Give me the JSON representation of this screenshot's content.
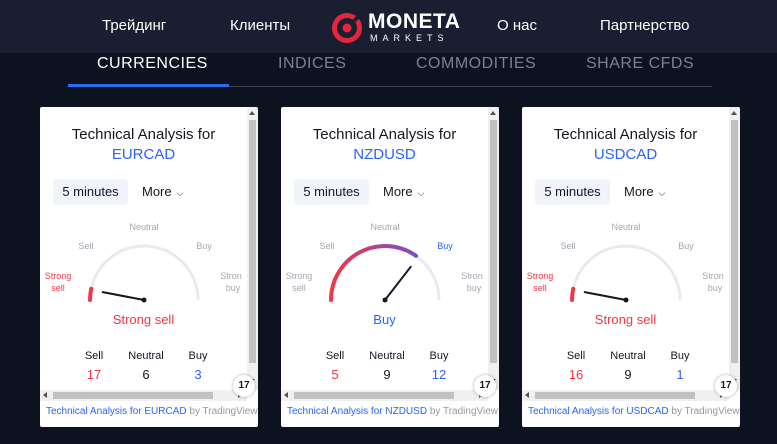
{
  "nav": {
    "items": [
      "Трейдинг",
      "Клиенты",
      "О нас",
      "Партнерство"
    ],
    "logo": {
      "name": "MONETA",
      "sub": "MARKETS"
    }
  },
  "tabs": [
    "CURRENCIES",
    "INDICES",
    "COMMODITIES",
    "SHARE CFDS"
  ],
  "active_tab": "CURRENCIES",
  "colors": {
    "background": "#0d1220",
    "header": "#191f30",
    "accent": "#2a6cf0",
    "sell": "#f23645",
    "buy": "#2962ff",
    "logo_red": "#e3263c"
  },
  "widgets": [
    {
      "title": "Technical Analysis for",
      "symbol": "EURCAD",
      "interval": "5 minutes",
      "more_label": "More",
      "gauge_labels": {
        "neutral": "Neutral",
        "sell": "Sell",
        "buy": "Buy",
        "strong_sell_1": "Strong",
        "strong_sell_2": "sell",
        "strong_buy_1": "Stron",
        "strong_buy_2": "buy"
      },
      "needle_value": -0.88,
      "result": "Strong sell",
      "result_type": "sell",
      "counts": {
        "sell_label": "Sell",
        "neutral_label": "Neutral",
        "buy_label": "Buy",
        "sell": "17",
        "neutral": "6",
        "buy": "3"
      },
      "footer": {
        "link": "Technical Analysis for EURCAD",
        "suffix": " by TradingView"
      },
      "badge": "17"
    },
    {
      "title": "Technical Analysis for",
      "symbol": "NZDUSD",
      "interval": "5 minutes",
      "more_label": "More",
      "gauge_labels": {
        "neutral": "Neutral",
        "sell": "Sell",
        "buy": "Buy",
        "strong_sell_1": "Strong",
        "strong_sell_2": "sell",
        "strong_buy_1": "Stron",
        "strong_buy_2": "buy"
      },
      "needle_value": 0.42,
      "result": "Buy",
      "result_type": "buy",
      "counts": {
        "sell_label": "Sell",
        "neutral_label": "Neutral",
        "buy_label": "Buy",
        "sell": "5",
        "neutral": "9",
        "buy": "12"
      },
      "footer": {
        "link": "Technical Analysis for NZDUSD",
        "suffix": " by TradingView"
      },
      "badge": "17"
    },
    {
      "title": "Technical Analysis for",
      "symbol": "USDCAD",
      "interval": "5 minutes",
      "more_label": "More",
      "gauge_labels": {
        "neutral": "Neutral",
        "sell": "Sell",
        "buy": "Buy",
        "strong_sell_1": "Strong",
        "strong_sell_2": "sell",
        "strong_buy_1": "Stron",
        "strong_buy_2": "buy"
      },
      "needle_value": -0.88,
      "result": "Strong sell",
      "result_type": "sell",
      "counts": {
        "sell_label": "Sell",
        "neutral_label": "Neutral",
        "buy_label": "Buy",
        "sell": "16",
        "neutral": "9",
        "buy": "1"
      },
      "footer": {
        "link": "Technical Analysis for USDCAD",
        "suffix": " by TradingView"
      },
      "badge": "17"
    }
  ]
}
